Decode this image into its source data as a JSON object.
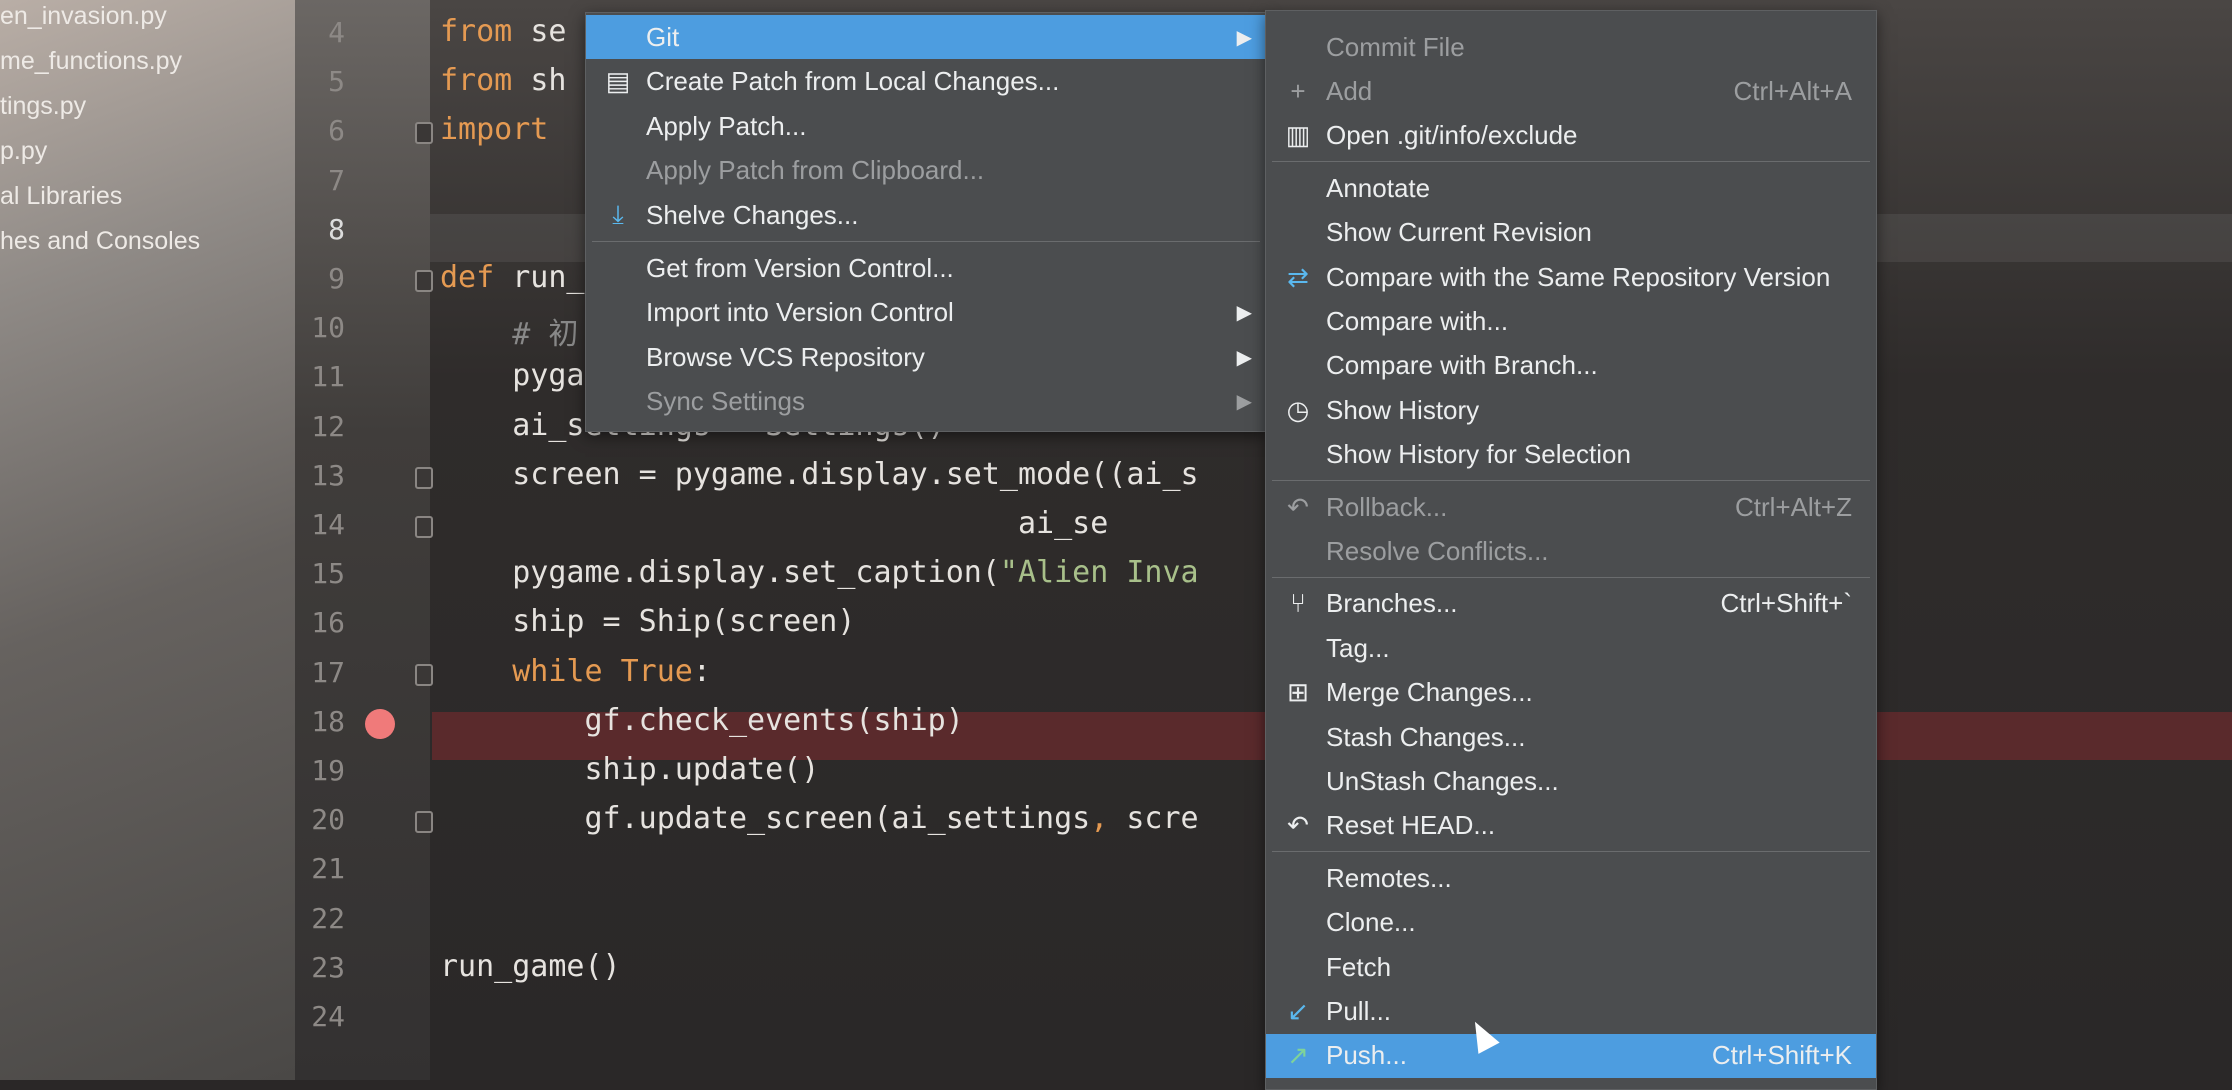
{
  "project_tree": [
    "en_invasion.py",
    "me_functions.py",
    "tings.py",
    "p.py",
    "al Libraries",
    "hes and Consoles"
  ],
  "editor": {
    "lines": [
      {
        "n": "4",
        "parts": [
          [
            "kw",
            "from "
          ],
          [
            "",
            "se"
          ]
        ]
      },
      {
        "n": "5",
        "parts": [
          [
            "kw",
            "from "
          ],
          [
            "",
            "sh"
          ]
        ]
      },
      {
        "n": "6",
        "parts": [
          [
            "kw",
            "import "
          ],
          [
            "",
            ""
          ]
        ]
      },
      {
        "n": "7",
        "parts": []
      },
      {
        "n": "8",
        "parts": [],
        "current": true
      },
      {
        "n": "9",
        "parts": [
          [
            "kw",
            "def "
          ],
          [
            "",
            "run_"
          ]
        ]
      },
      {
        "n": "10",
        "parts": [
          [
            "cm",
            "    # 初"
          ]
        ]
      },
      {
        "n": "11",
        "parts": [
          [
            "",
            "    pyga"
          ]
        ]
      },
      {
        "n": "12",
        "parts": [
          [
            "",
            "    ai_settings = Settings()"
          ]
        ]
      },
      {
        "n": "13",
        "parts": [
          [
            "",
            "    screen = pygame.display.set_mode((ai_s"
          ]
        ]
      },
      {
        "n": "14",
        "parts": [
          [
            "",
            "                                ai_se"
          ]
        ]
      },
      {
        "n": "15",
        "parts": [
          [
            "",
            "    pygame.display.set_caption("
          ],
          [
            "str",
            "\"Alien Inva"
          ]
        ]
      },
      {
        "n": "16",
        "parts": [
          [
            "",
            "    ship = Ship(screen)"
          ]
        ]
      },
      {
        "n": "17",
        "parts": [
          [
            "kw",
            "    while True"
          ],
          [
            "",
            ":"
          ]
        ]
      },
      {
        "n": "18",
        "parts": [
          [
            "",
            "        gf.check_events(ship)"
          ]
        ],
        "breakpoint": true
      },
      {
        "n": "19",
        "parts": [
          [
            "",
            "        ship.update()"
          ]
        ]
      },
      {
        "n": "20",
        "parts": [
          [
            "",
            "        gf.update_screen(ai_settings"
          ],
          [
            "kw",
            ","
          ],
          [
            "",
            " scre"
          ]
        ]
      },
      {
        "n": "21",
        "parts": []
      },
      {
        "n": "22",
        "parts": []
      },
      {
        "n": "23",
        "parts": [
          [
            "",
            "run_game()"
          ]
        ]
      },
      {
        "n": "24",
        "parts": []
      }
    ]
  },
  "vcs_menu": {
    "items": [
      {
        "label": "Git",
        "selected": true,
        "submenu": true
      },
      {
        "label": "Create Patch from Local Changes...",
        "icon": "patch-icon"
      },
      {
        "label": "Apply Patch..."
      },
      {
        "label": "Apply Patch from Clipboard...",
        "disabled": true
      },
      {
        "label": "Shelve Changes...",
        "icon": "shelve-icon",
        "sep_after": true
      },
      {
        "label": "Get from Version Control..."
      },
      {
        "label": "Import into Version Control",
        "submenu": true
      },
      {
        "label": "Browse VCS Repository",
        "submenu": true
      },
      {
        "label": "Sync Settings",
        "disabled": true,
        "submenu": true
      }
    ]
  },
  "git_menu": {
    "items": [
      {
        "label": "Commit File",
        "disabled": true
      },
      {
        "label": "Add",
        "icon": "plus-icon",
        "shortcut": "Ctrl+Alt+A",
        "disabled": true
      },
      {
        "label": "Open .git/info/exclude",
        "icon": "file-exclude-icon",
        "sep_after": true
      },
      {
        "label": "Annotate"
      },
      {
        "label": "Show Current Revision"
      },
      {
        "label": "Compare with the Same Repository Version",
        "icon": "compare-icon"
      },
      {
        "label": "Compare with..."
      },
      {
        "label": "Compare with Branch..."
      },
      {
        "label": "Show History",
        "icon": "clock-icon"
      },
      {
        "label": "Show History for Selection",
        "sep_after": true
      },
      {
        "label": "Rollback...",
        "icon": "rollback-icon",
        "shortcut": "Ctrl+Alt+Z",
        "disabled": true
      },
      {
        "label": "Resolve Conflicts...",
        "disabled": true,
        "sep_after": true
      },
      {
        "label": "Branches...",
        "icon": "branch-icon",
        "shortcut": "Ctrl+Shift+`"
      },
      {
        "label": "Tag..."
      },
      {
        "label": "Merge Changes...",
        "icon": "merge-icon"
      },
      {
        "label": "Stash Changes..."
      },
      {
        "label": "UnStash Changes..."
      },
      {
        "label": "Reset HEAD...",
        "icon": "reset-icon",
        "sep_after": true
      },
      {
        "label": "Remotes..."
      },
      {
        "label": "Clone..."
      },
      {
        "label": "Fetch"
      },
      {
        "label": "Pull...",
        "icon": "pull-icon"
      },
      {
        "label": "Push...",
        "icon": "push-icon",
        "shortcut": "Ctrl+Shift+K",
        "selected": true
      }
    ]
  },
  "colors": {
    "selection": "#4d9de0",
    "breakpoint": "#f07a7a",
    "breakpoint_line": "#5a2a2c",
    "keyword": "#e59a52",
    "string": "#a8c08a"
  }
}
